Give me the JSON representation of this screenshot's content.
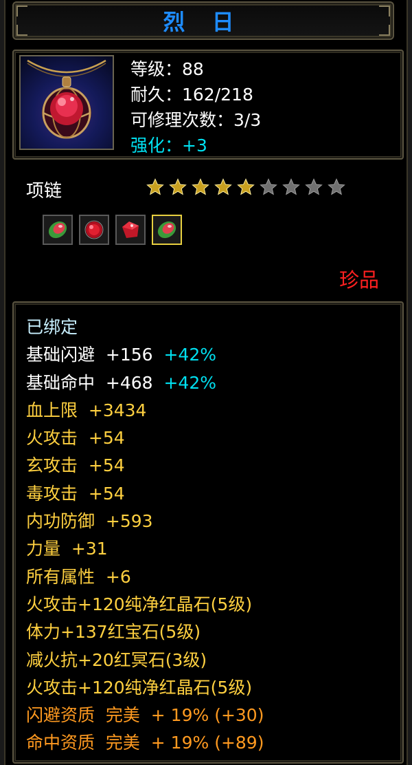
{
  "title": "烈 日",
  "item": {
    "level_label": "等级：88",
    "durability_label": "耐久：162/218",
    "repair_label": "可修理次数：3/3",
    "enhance_label": "强化：+3",
    "type": "项链",
    "stars_filled": 5,
    "stars_total": 9,
    "rarity": "珍品"
  },
  "gems": [
    {
      "name": "green-red-gem-icon"
    },
    {
      "name": "red-round-gem-icon"
    },
    {
      "name": "red-crystal-gem-icon"
    },
    {
      "name": "green-red-gem-icon"
    }
  ],
  "attributes": {
    "bound": "已绑定",
    "dodge": {
      "label": "基础闪避  +156",
      "bonus": "+42%"
    },
    "hit": {
      "label": "基础命中  +468",
      "bonus": "+42%"
    },
    "lines": [
      "血上限  +3434",
      "火攻击  +54",
      "玄攻击  +54",
      "毒攻击  +54",
      "内功防御  +593",
      "力量  +31",
      "所有属性  +6"
    ],
    "gem_lines": [
      "火攻击+120纯净红晶石(5级)",
      "体力+137红宝石(5级)",
      "减火抗+20红冥石(3级)",
      "火攻击+120纯净红晶石(5级)"
    ],
    "quality_lines": [
      "闪避资质  完美  + 19% (+30)",
      "命中资质  完美  + 19% (+89)"
    ]
  },
  "colors": {
    "title": "#1e8cff",
    "highlight": "#00e0f0",
    "attribute": "#ffd040",
    "quality": "#ff9a20",
    "rarity": "#ff2020",
    "star_filled": "#c8a020",
    "star_empty": "#707070"
  }
}
